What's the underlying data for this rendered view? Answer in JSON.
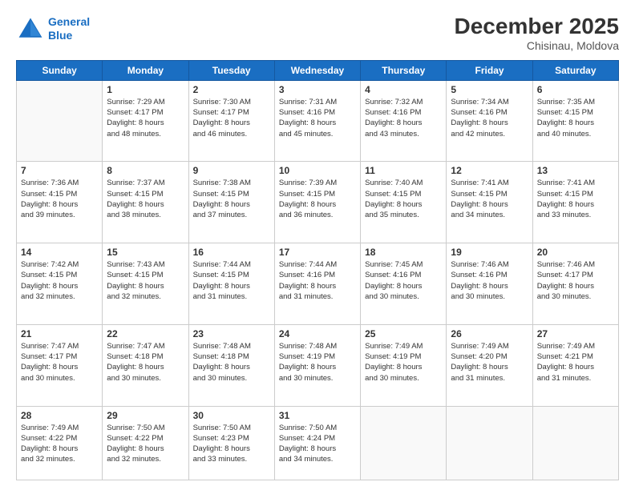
{
  "logo": {
    "line1": "General",
    "line2": "Blue"
  },
  "title": "December 2025",
  "subtitle": "Chisinau, Moldova",
  "days": [
    "Sunday",
    "Monday",
    "Tuesday",
    "Wednesday",
    "Thursday",
    "Friday",
    "Saturday"
  ],
  "weeks": [
    [
      {
        "day": "",
        "info": ""
      },
      {
        "day": "1",
        "info": "Sunrise: 7:29 AM\nSunset: 4:17 PM\nDaylight: 8 hours\nand 48 minutes."
      },
      {
        "day": "2",
        "info": "Sunrise: 7:30 AM\nSunset: 4:17 PM\nDaylight: 8 hours\nand 46 minutes."
      },
      {
        "day": "3",
        "info": "Sunrise: 7:31 AM\nSunset: 4:16 PM\nDaylight: 8 hours\nand 45 minutes."
      },
      {
        "day": "4",
        "info": "Sunrise: 7:32 AM\nSunset: 4:16 PM\nDaylight: 8 hours\nand 43 minutes."
      },
      {
        "day": "5",
        "info": "Sunrise: 7:34 AM\nSunset: 4:16 PM\nDaylight: 8 hours\nand 42 minutes."
      },
      {
        "day": "6",
        "info": "Sunrise: 7:35 AM\nSunset: 4:15 PM\nDaylight: 8 hours\nand 40 minutes."
      }
    ],
    [
      {
        "day": "7",
        "info": "Sunrise: 7:36 AM\nSunset: 4:15 PM\nDaylight: 8 hours\nand 39 minutes."
      },
      {
        "day": "8",
        "info": "Sunrise: 7:37 AM\nSunset: 4:15 PM\nDaylight: 8 hours\nand 38 minutes."
      },
      {
        "day": "9",
        "info": "Sunrise: 7:38 AM\nSunset: 4:15 PM\nDaylight: 8 hours\nand 37 minutes."
      },
      {
        "day": "10",
        "info": "Sunrise: 7:39 AM\nSunset: 4:15 PM\nDaylight: 8 hours\nand 36 minutes."
      },
      {
        "day": "11",
        "info": "Sunrise: 7:40 AM\nSunset: 4:15 PM\nDaylight: 8 hours\nand 35 minutes."
      },
      {
        "day": "12",
        "info": "Sunrise: 7:41 AM\nSunset: 4:15 PM\nDaylight: 8 hours\nand 34 minutes."
      },
      {
        "day": "13",
        "info": "Sunrise: 7:41 AM\nSunset: 4:15 PM\nDaylight: 8 hours\nand 33 minutes."
      }
    ],
    [
      {
        "day": "14",
        "info": "Sunrise: 7:42 AM\nSunset: 4:15 PM\nDaylight: 8 hours\nand 32 minutes."
      },
      {
        "day": "15",
        "info": "Sunrise: 7:43 AM\nSunset: 4:15 PM\nDaylight: 8 hours\nand 32 minutes."
      },
      {
        "day": "16",
        "info": "Sunrise: 7:44 AM\nSunset: 4:15 PM\nDaylight: 8 hours\nand 31 minutes."
      },
      {
        "day": "17",
        "info": "Sunrise: 7:44 AM\nSunset: 4:16 PM\nDaylight: 8 hours\nand 31 minutes."
      },
      {
        "day": "18",
        "info": "Sunrise: 7:45 AM\nSunset: 4:16 PM\nDaylight: 8 hours\nand 30 minutes."
      },
      {
        "day": "19",
        "info": "Sunrise: 7:46 AM\nSunset: 4:16 PM\nDaylight: 8 hours\nand 30 minutes."
      },
      {
        "day": "20",
        "info": "Sunrise: 7:46 AM\nSunset: 4:17 PM\nDaylight: 8 hours\nand 30 minutes."
      }
    ],
    [
      {
        "day": "21",
        "info": "Sunrise: 7:47 AM\nSunset: 4:17 PM\nDaylight: 8 hours\nand 30 minutes."
      },
      {
        "day": "22",
        "info": "Sunrise: 7:47 AM\nSunset: 4:18 PM\nDaylight: 8 hours\nand 30 minutes."
      },
      {
        "day": "23",
        "info": "Sunrise: 7:48 AM\nSunset: 4:18 PM\nDaylight: 8 hours\nand 30 minutes."
      },
      {
        "day": "24",
        "info": "Sunrise: 7:48 AM\nSunset: 4:19 PM\nDaylight: 8 hours\nand 30 minutes."
      },
      {
        "day": "25",
        "info": "Sunrise: 7:49 AM\nSunset: 4:19 PM\nDaylight: 8 hours\nand 30 minutes."
      },
      {
        "day": "26",
        "info": "Sunrise: 7:49 AM\nSunset: 4:20 PM\nDaylight: 8 hours\nand 31 minutes."
      },
      {
        "day": "27",
        "info": "Sunrise: 7:49 AM\nSunset: 4:21 PM\nDaylight: 8 hours\nand 31 minutes."
      }
    ],
    [
      {
        "day": "28",
        "info": "Sunrise: 7:49 AM\nSunset: 4:22 PM\nDaylight: 8 hours\nand 32 minutes."
      },
      {
        "day": "29",
        "info": "Sunrise: 7:50 AM\nSunset: 4:22 PM\nDaylight: 8 hours\nand 32 minutes."
      },
      {
        "day": "30",
        "info": "Sunrise: 7:50 AM\nSunset: 4:23 PM\nDaylight: 8 hours\nand 33 minutes."
      },
      {
        "day": "31",
        "info": "Sunrise: 7:50 AM\nSunset: 4:24 PM\nDaylight: 8 hours\nand 34 minutes."
      },
      {
        "day": "",
        "info": ""
      },
      {
        "day": "",
        "info": ""
      },
      {
        "day": "",
        "info": ""
      }
    ]
  ]
}
